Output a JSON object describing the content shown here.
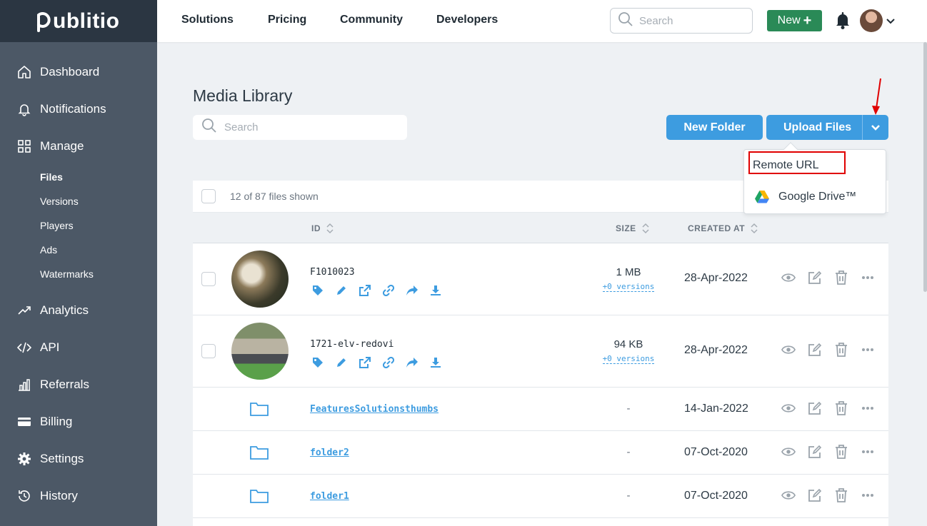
{
  "app": {
    "logo": "ublitio",
    "logo_prefix": "p"
  },
  "topnav": {
    "links": [
      "Solutions",
      "Pricing",
      "Community",
      "Developers"
    ],
    "search_placeholder": "Search",
    "new_label": "New"
  },
  "sidebar": {
    "items": [
      {
        "label": "Dashboard",
        "icon": "home-icon"
      },
      {
        "label": "Notifications",
        "icon": "bell-icon"
      },
      {
        "label": "Manage",
        "icon": "grid-icon"
      }
    ],
    "sub_items": [
      "Files",
      "Versions",
      "Players",
      "Ads",
      "Watermarks"
    ],
    "items_bottom": [
      {
        "label": "Analytics",
        "icon": "trend-icon"
      },
      {
        "label": "API",
        "icon": "code-icon"
      },
      {
        "label": "Referrals",
        "icon": "chart-icon"
      },
      {
        "label": "Billing",
        "icon": "card-icon"
      },
      {
        "label": "Settings",
        "icon": "gear-icon"
      },
      {
        "label": "History",
        "icon": "history-icon"
      }
    ]
  },
  "main": {
    "title": "Media Library",
    "search_placeholder": "Search",
    "new_folder_label": "New Folder",
    "upload_label": "Upload Files",
    "upload_menu": {
      "remote_url": "Remote URL",
      "google_drive": "Google Drive™"
    },
    "table": {
      "shown_text": "12 of 87 files shown",
      "col_id": "ID",
      "col_size": "SIZE",
      "col_created": "CREATED AT",
      "files": [
        {
          "id": "F1010023",
          "size": "1 MB",
          "versions": "+0 versions",
          "created": "28-Apr-2022"
        },
        {
          "id": "1721-elv-redovi",
          "size": "94 KB",
          "versions": "+0 versions",
          "created": "28-Apr-2022"
        }
      ],
      "folders": [
        {
          "name": "FeaturesSolutionsthumbs",
          "size": "-",
          "created": "14-Jan-2022"
        },
        {
          "name": "folder2",
          "size": "-",
          "created": "07-Oct-2020"
        },
        {
          "name": "folder1",
          "size": "-",
          "created": "07-Oct-2020"
        }
      ]
    }
  },
  "colors": {
    "accent": "#3d9ce0",
    "sidebar": "#4c5866",
    "new_button": "#2a8a57",
    "highlight": "#e00000"
  }
}
